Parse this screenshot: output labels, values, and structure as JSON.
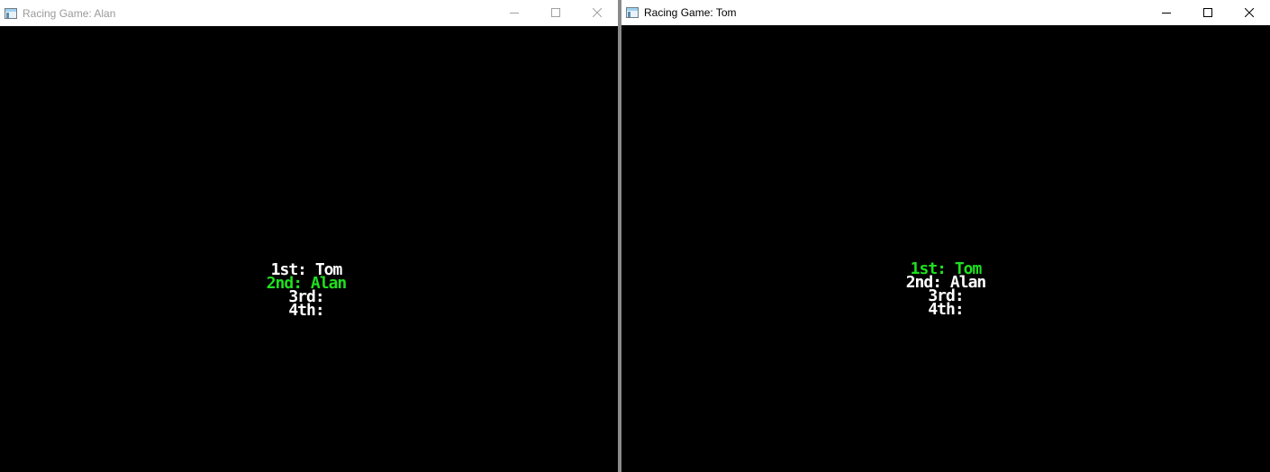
{
  "windows": {
    "left": {
      "title": "Racing Game: Alan",
      "standings": [
        {
          "label": "1st: Tom",
          "color": "#ffffff"
        },
        {
          "label": "2nd: Alan",
          "color": "#1ee01e"
        },
        {
          "label": "3rd:",
          "color": "#ffffff"
        },
        {
          "label": "4th:",
          "color": "#ffffff"
        }
      ]
    },
    "right": {
      "title": "Racing Game: Tom",
      "standings": [
        {
          "label": "1st: Tom",
          "color": "#1ee01e"
        },
        {
          "label": "2nd: Alan",
          "color": "#ffffff"
        },
        {
          "label": "3rd:",
          "color": "#ffffff"
        },
        {
          "label": "4th:",
          "color": "#ffffff"
        }
      ]
    }
  },
  "icons": {
    "app": "window-app-icon",
    "minimize": "minimize-icon",
    "maximize": "maximize-icon",
    "close": "close-icon"
  },
  "colors": {
    "highlight": "#1ee01e",
    "text": "#ffffff",
    "background": "#000000"
  }
}
